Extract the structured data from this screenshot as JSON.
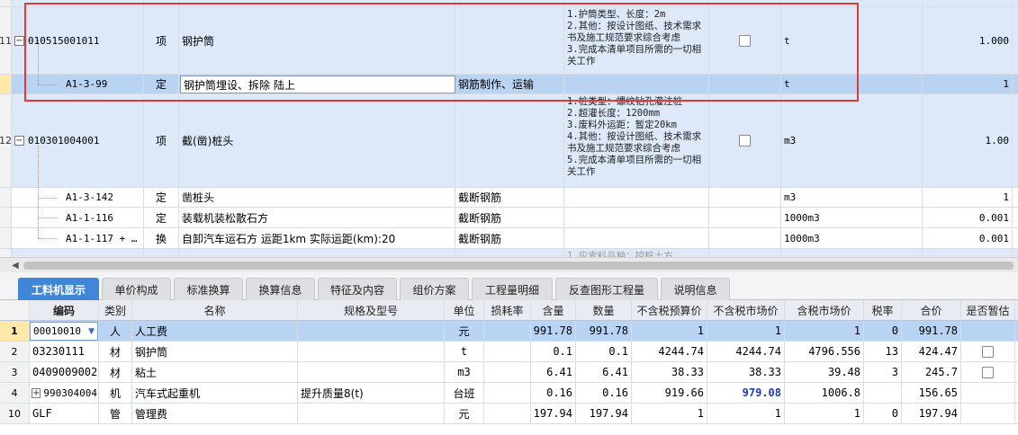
{
  "top_rows": [
    {
      "row_num": "11",
      "code": "010515001011",
      "type": "项",
      "name": "钢护筒",
      "extra": "",
      "features": "1.护筒类型、长度：2m\n2.其他：按设计图纸、技术需求书及施工规范要求综合考虑\n3.完成本清单项目所需的一切相关工作",
      "unit": "t",
      "quantity": "1.000"
    },
    {
      "row_num": "",
      "code": "A1-3-99",
      "type": "定",
      "name": "钢护筒埋设、拆除 陆上",
      "extra": "钢筋制作、运输",
      "features": "",
      "unit": "t",
      "quantity": "1"
    },
    {
      "row_num": "12",
      "code": "010301004001",
      "type": "项",
      "name": "截(凿)桩头",
      "extra": "",
      "features": "1.桩类型：螺纹钻孔灌注桩\n2.超灌长度：1200mm\n3.废料外运距：暂定20km\n4.其他：按设计图纸、技术需求书及施工规范要求综合考虑\n5.完成本清单项目所需的一切相关工作",
      "unit": "m3",
      "quantity": "1.00"
    },
    {
      "row_num": "",
      "code": "A1-3-142",
      "type": "定",
      "name": "凿桩头",
      "extra": "截断钢筋",
      "features": "",
      "unit": "m3",
      "quantity": "1"
    },
    {
      "row_num": "",
      "code": "A1-1-116",
      "type": "定",
      "name": "装载机装松散石方",
      "extra": "截断钢筋",
      "features": "",
      "unit": "1000m3",
      "quantity": "0.001"
    },
    {
      "row_num": "",
      "code": "A1-1-117 + …",
      "type": "换",
      "name": "自卸汽车运石方 运距1km  实际运距(km):20",
      "extra": "截断钢筋",
      "features": "",
      "unit": "1000m3",
      "quantity": "0.001"
    }
  ],
  "partial_next_row_text": "1.应索料品种：控桩土方",
  "tabs": [
    {
      "label": "工料机显示",
      "active": true
    },
    {
      "label": "单价构成",
      "active": false
    },
    {
      "label": "标准换算",
      "active": false
    },
    {
      "label": "换算信息",
      "active": false
    },
    {
      "label": "特征及内容",
      "active": false
    },
    {
      "label": "组价方案",
      "active": false
    },
    {
      "label": "工程量明细",
      "active": false
    },
    {
      "label": "反查图形工程量",
      "active": false
    },
    {
      "label": "说明信息",
      "active": false
    }
  ],
  "bottom_headers": [
    "编码",
    "类别",
    "名称",
    "规格及型号",
    "单位",
    "损耗率",
    "含量",
    "数量",
    "不含税预算价",
    "不含税市场价",
    "含税市场价",
    "税率",
    "合价",
    "是否暂估"
  ],
  "bottom_rows": [
    {
      "row_num": "1",
      "code": "00010010",
      "cat": "人",
      "name": "人工费",
      "spec": "",
      "unit": "元",
      "loss": "",
      "content": "991.78",
      "qty": "991.78",
      "budget": "1",
      "market": "1",
      "tax_market": "1",
      "tax_rate": "0",
      "total": "991.78",
      "has_checkbox": false
    },
    {
      "row_num": "2",
      "code": "03230111",
      "cat": "材",
      "name": "钢护筒",
      "spec": "",
      "unit": "t",
      "loss": "",
      "content": "0.1",
      "qty": "0.1",
      "budget": "4244.74",
      "market": "4244.74",
      "tax_market": "4796.556",
      "tax_rate": "13",
      "total": "424.47",
      "has_checkbox": true
    },
    {
      "row_num": "3",
      "code": "0409009002",
      "cat": "材",
      "name": "粘土",
      "spec": "",
      "unit": "m3",
      "loss": "",
      "content": "6.41",
      "qty": "6.41",
      "budget": "38.33",
      "market": "38.33",
      "tax_market": "39.48",
      "tax_rate": "3",
      "total": "245.7",
      "has_checkbox": true
    },
    {
      "row_num": "4",
      "code": "990304004",
      "cat": "机",
      "name": "汽车式起重机",
      "spec": "提升质量8(t)",
      "unit": "台班",
      "loss": "",
      "content": "0.16",
      "qty": "0.16",
      "budget": "919.66",
      "market": "979.08",
      "tax_market": "1006.8",
      "tax_rate": "",
      "total": "156.65",
      "has_checkbox": false
    },
    {
      "row_num": "10",
      "code": "GLF",
      "cat": "管",
      "name": "管理费",
      "spec": "",
      "unit": "元",
      "loss": "",
      "content": "197.94",
      "qty": "197.94",
      "budget": "1",
      "market": "1",
      "tax_market": "1",
      "tax_rate": "0",
      "total": "197.94",
      "has_checkbox": false
    }
  ],
  "colors": {
    "highlight": "#e53935",
    "selected_row": "#b9d3f3",
    "list_row": "#dde8f8",
    "active_tab": "#3f87d6"
  }
}
